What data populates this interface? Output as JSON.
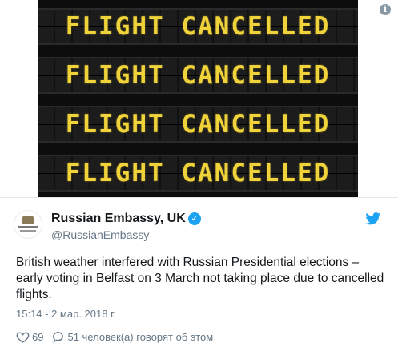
{
  "board": {
    "rows": [
      "FLIGHT CANCELLED",
      "FLIGHT CANCELLED",
      "FLIGHT CANCELLED",
      "FLIGHT CANCELLED"
    ],
    "text_color": "#f0d23a"
  },
  "info_icon": "info-icon",
  "author": {
    "display_name": "Russian Embassy, UK",
    "handle": "@RussianEmbassy",
    "verified": true,
    "avatar_icon": "embassy-crest-logo"
  },
  "tweet": {
    "text": "British weather interfered with Russian Presidential elections – early voting in Belfast on 3 March not taking place due to cancelled flights.",
    "timestamp": "15:14 - 2 мар. 2018 г."
  },
  "actions": {
    "likes_count": "69",
    "replies_label": "51 человек(а) говорят об этом"
  },
  "colors": {
    "accent": "#1da1f2",
    "muted": "#657786"
  }
}
